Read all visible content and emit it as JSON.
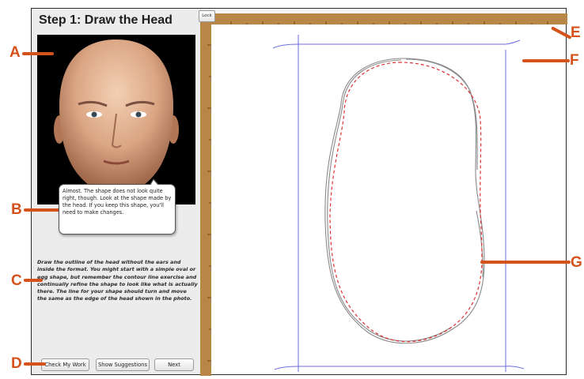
{
  "panel": {
    "title": "Step 1: Draw the Head",
    "feedback": "Almost. The shape does not look quite right, though. Look at the shape made by the head. If you keep this shape, you'll need to make changes.",
    "instructions": "Draw the outline of the head without the ears and inside the format. You might start with a simple oval or egg shape, but remember the contour line exercise and continually refine the shape to look like what is actually there. The line for your shape should turn and move the same as the edge of the head shown in the photo."
  },
  "buttons": {
    "check": "Check My Work",
    "suggestions": "Show Suggestions",
    "next": "Next"
  },
  "canvas": {
    "lock_label": "Lock"
  },
  "callouts": {
    "a": "A",
    "b": "B",
    "c": "C",
    "d": "D",
    "e": "E",
    "f": "F",
    "g": "G"
  },
  "colors": {
    "callout": "#d4521b",
    "ruler": "#b88748",
    "format_lines": "#6b6be0",
    "drawn_outline": "#8a8a8a",
    "suggested_outline": "#dd3333"
  }
}
